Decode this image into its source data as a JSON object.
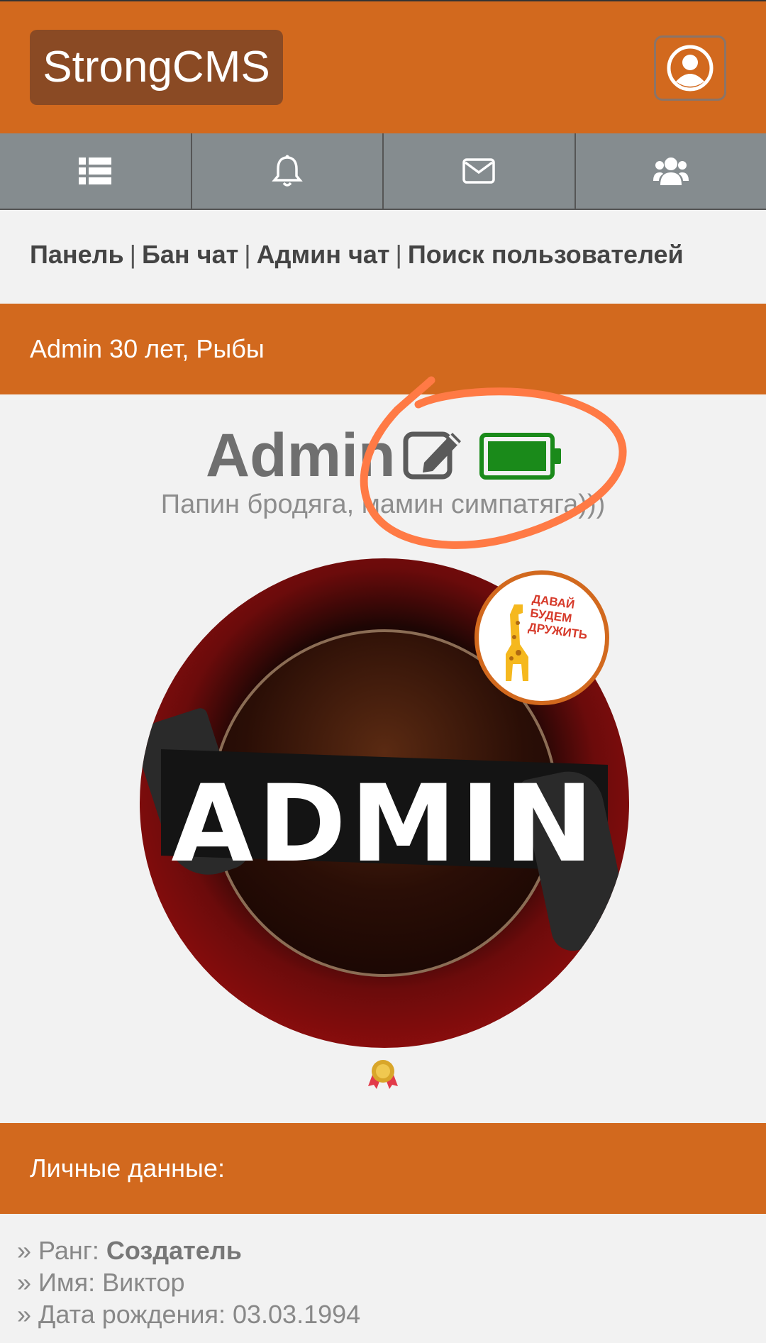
{
  "header": {
    "logo": "StrongCMS",
    "profile_icon": "user-circle-icon"
  },
  "navbar": {
    "items": [
      {
        "icon": "list-icon"
      },
      {
        "icon": "bell-icon"
      },
      {
        "icon": "envelope-icon"
      },
      {
        "icon": "users-icon"
      }
    ]
  },
  "links": [
    "Панель",
    "Бан чат",
    "Админ чат",
    "Поиск пользователей"
  ],
  "profile": {
    "header_bar": "Admin 30 лет, Рыбы",
    "username": "Admin",
    "status_text": "Папин бродяга, мамин симпатяга)))",
    "avatar_text": "ADMIN",
    "sticker_text": [
      "ДАВАЙ",
      "БУДЕМ",
      "ДРУЖИТЬ"
    ],
    "battery_level": 1.0,
    "battery_color": "#1a8a1a",
    "accent_color": "#d2691e",
    "highlight_color": "#ff7a45"
  },
  "personal": {
    "title": "Личные данные:",
    "rank_label": "» Ранг: ",
    "rank_value": "Создатель",
    "name_label": "» Имя: ",
    "name_value": "Виктор",
    "birth_label": "» Дата рождения: ",
    "birth_value": "03.03.1994"
  }
}
